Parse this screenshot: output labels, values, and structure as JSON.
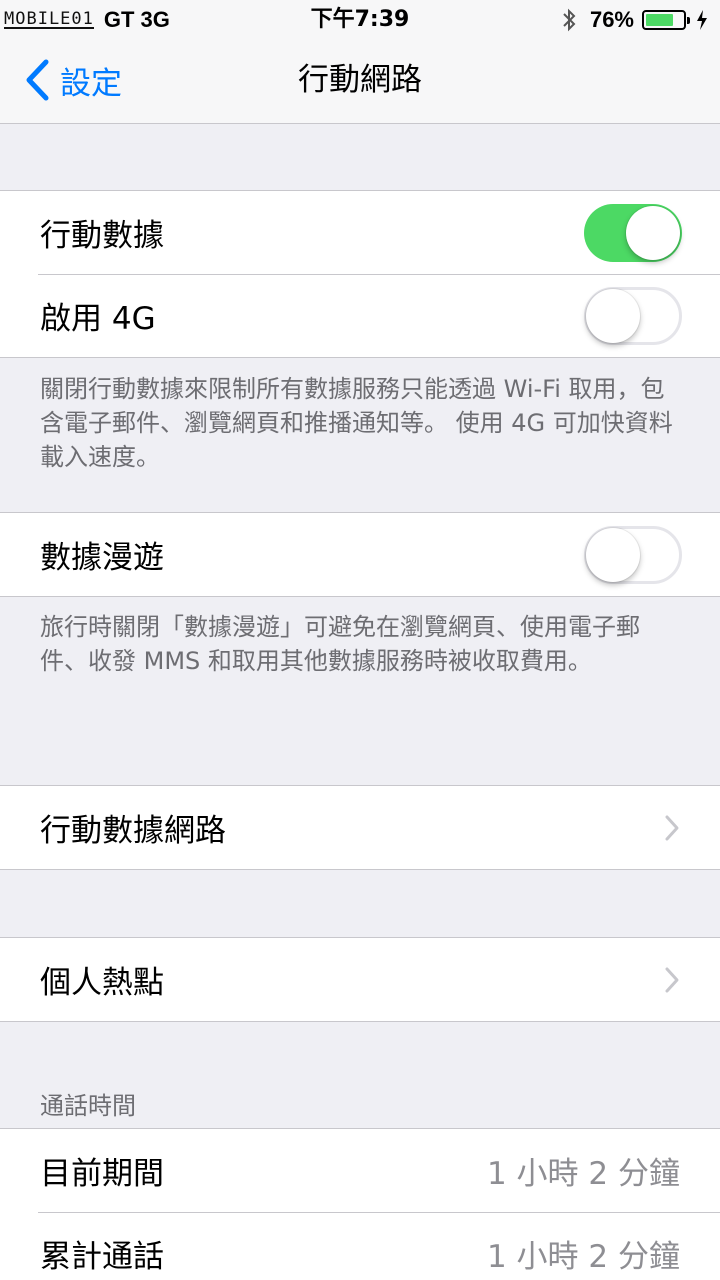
{
  "status_bar": {
    "watermark": "MOBILE01",
    "carrier": "GT 3G",
    "time": "下午7:39",
    "battery_percent": "76%",
    "battery_level": 0.76,
    "battery_color": "#4cd964",
    "icons": [
      "bluetooth-icon",
      "battery-icon",
      "charging-bolt-icon"
    ]
  },
  "nav": {
    "back_label": "設定",
    "title": "行動網路",
    "accent": "#007aff"
  },
  "cellular_group": {
    "items": [
      {
        "label": "行動數據",
        "toggle": true
      },
      {
        "label": "啟用 4G",
        "toggle": false
      }
    ],
    "footer": "關閉行動數據來限制所有數據服務只能透過 Wi-Fi 取用，包含電子郵件、瀏覽網頁和推播通知等。 使用 4G 可加快資料載入速度。"
  },
  "roaming_group": {
    "items": [
      {
        "label": "數據漫遊",
        "toggle": false
      }
    ],
    "footer": "旅行時關閉「數據漫遊」可避免在瀏覽網頁、使用電子郵件、收發 MMS 和取用其他數據服務時被收取費用。"
  },
  "cellular_network": {
    "label": "行動數據網路"
  },
  "hotspot": {
    "label": "個人熱點"
  },
  "call_time": {
    "header": "通話時間",
    "items": [
      {
        "label": "目前期間",
        "value": "1 小時 2 分鐘"
      },
      {
        "label": "累計通話",
        "value": "1 小時 2 分鐘"
      }
    ]
  },
  "colors": {
    "switch_on": "#4cd964",
    "background": "#efeff4"
  }
}
